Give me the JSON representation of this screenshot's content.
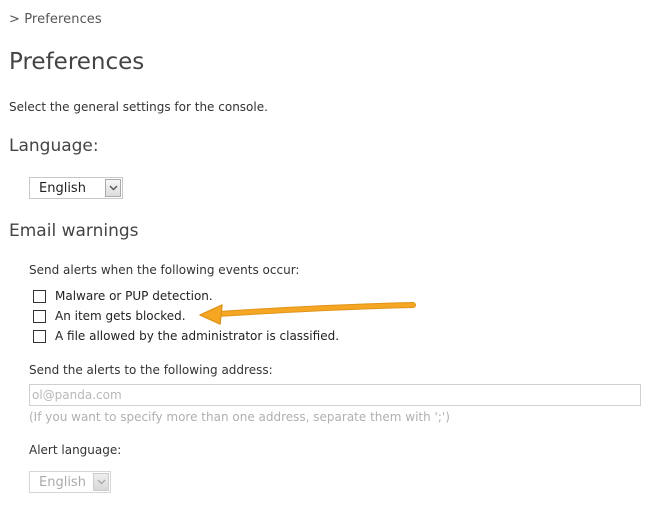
{
  "breadcrumb": {
    "text": "> Preferences"
  },
  "page": {
    "title": "Preferences",
    "subtitle": "Select the general settings for the console."
  },
  "language": {
    "heading": "Language:",
    "selected": "English"
  },
  "email": {
    "heading": "Email warnings",
    "events_label": "Send alerts when the following events occur:",
    "events": [
      {
        "label": "Malware or PUP detection.",
        "checked": false
      },
      {
        "label": "An item gets blocked.",
        "checked": false
      },
      {
        "label": "A file allowed by the administrator is classified.",
        "checked": false
      }
    ],
    "address_label": "Send the alerts to the following address:",
    "address_placeholder": "ol@panda.com",
    "address_value": "",
    "hint": "(If you want to specify more than one address, separate them with ';')",
    "alert_language_label": "Alert language:",
    "alert_language_selected": "English"
  },
  "icons": {
    "select_arrow": "chevron-down-icon",
    "annotation_arrow": "arrow-left-icon"
  },
  "colors": {
    "annotation_arrow": "#f5a623",
    "text": "#333333",
    "placeholder": "#b8b8b8"
  }
}
